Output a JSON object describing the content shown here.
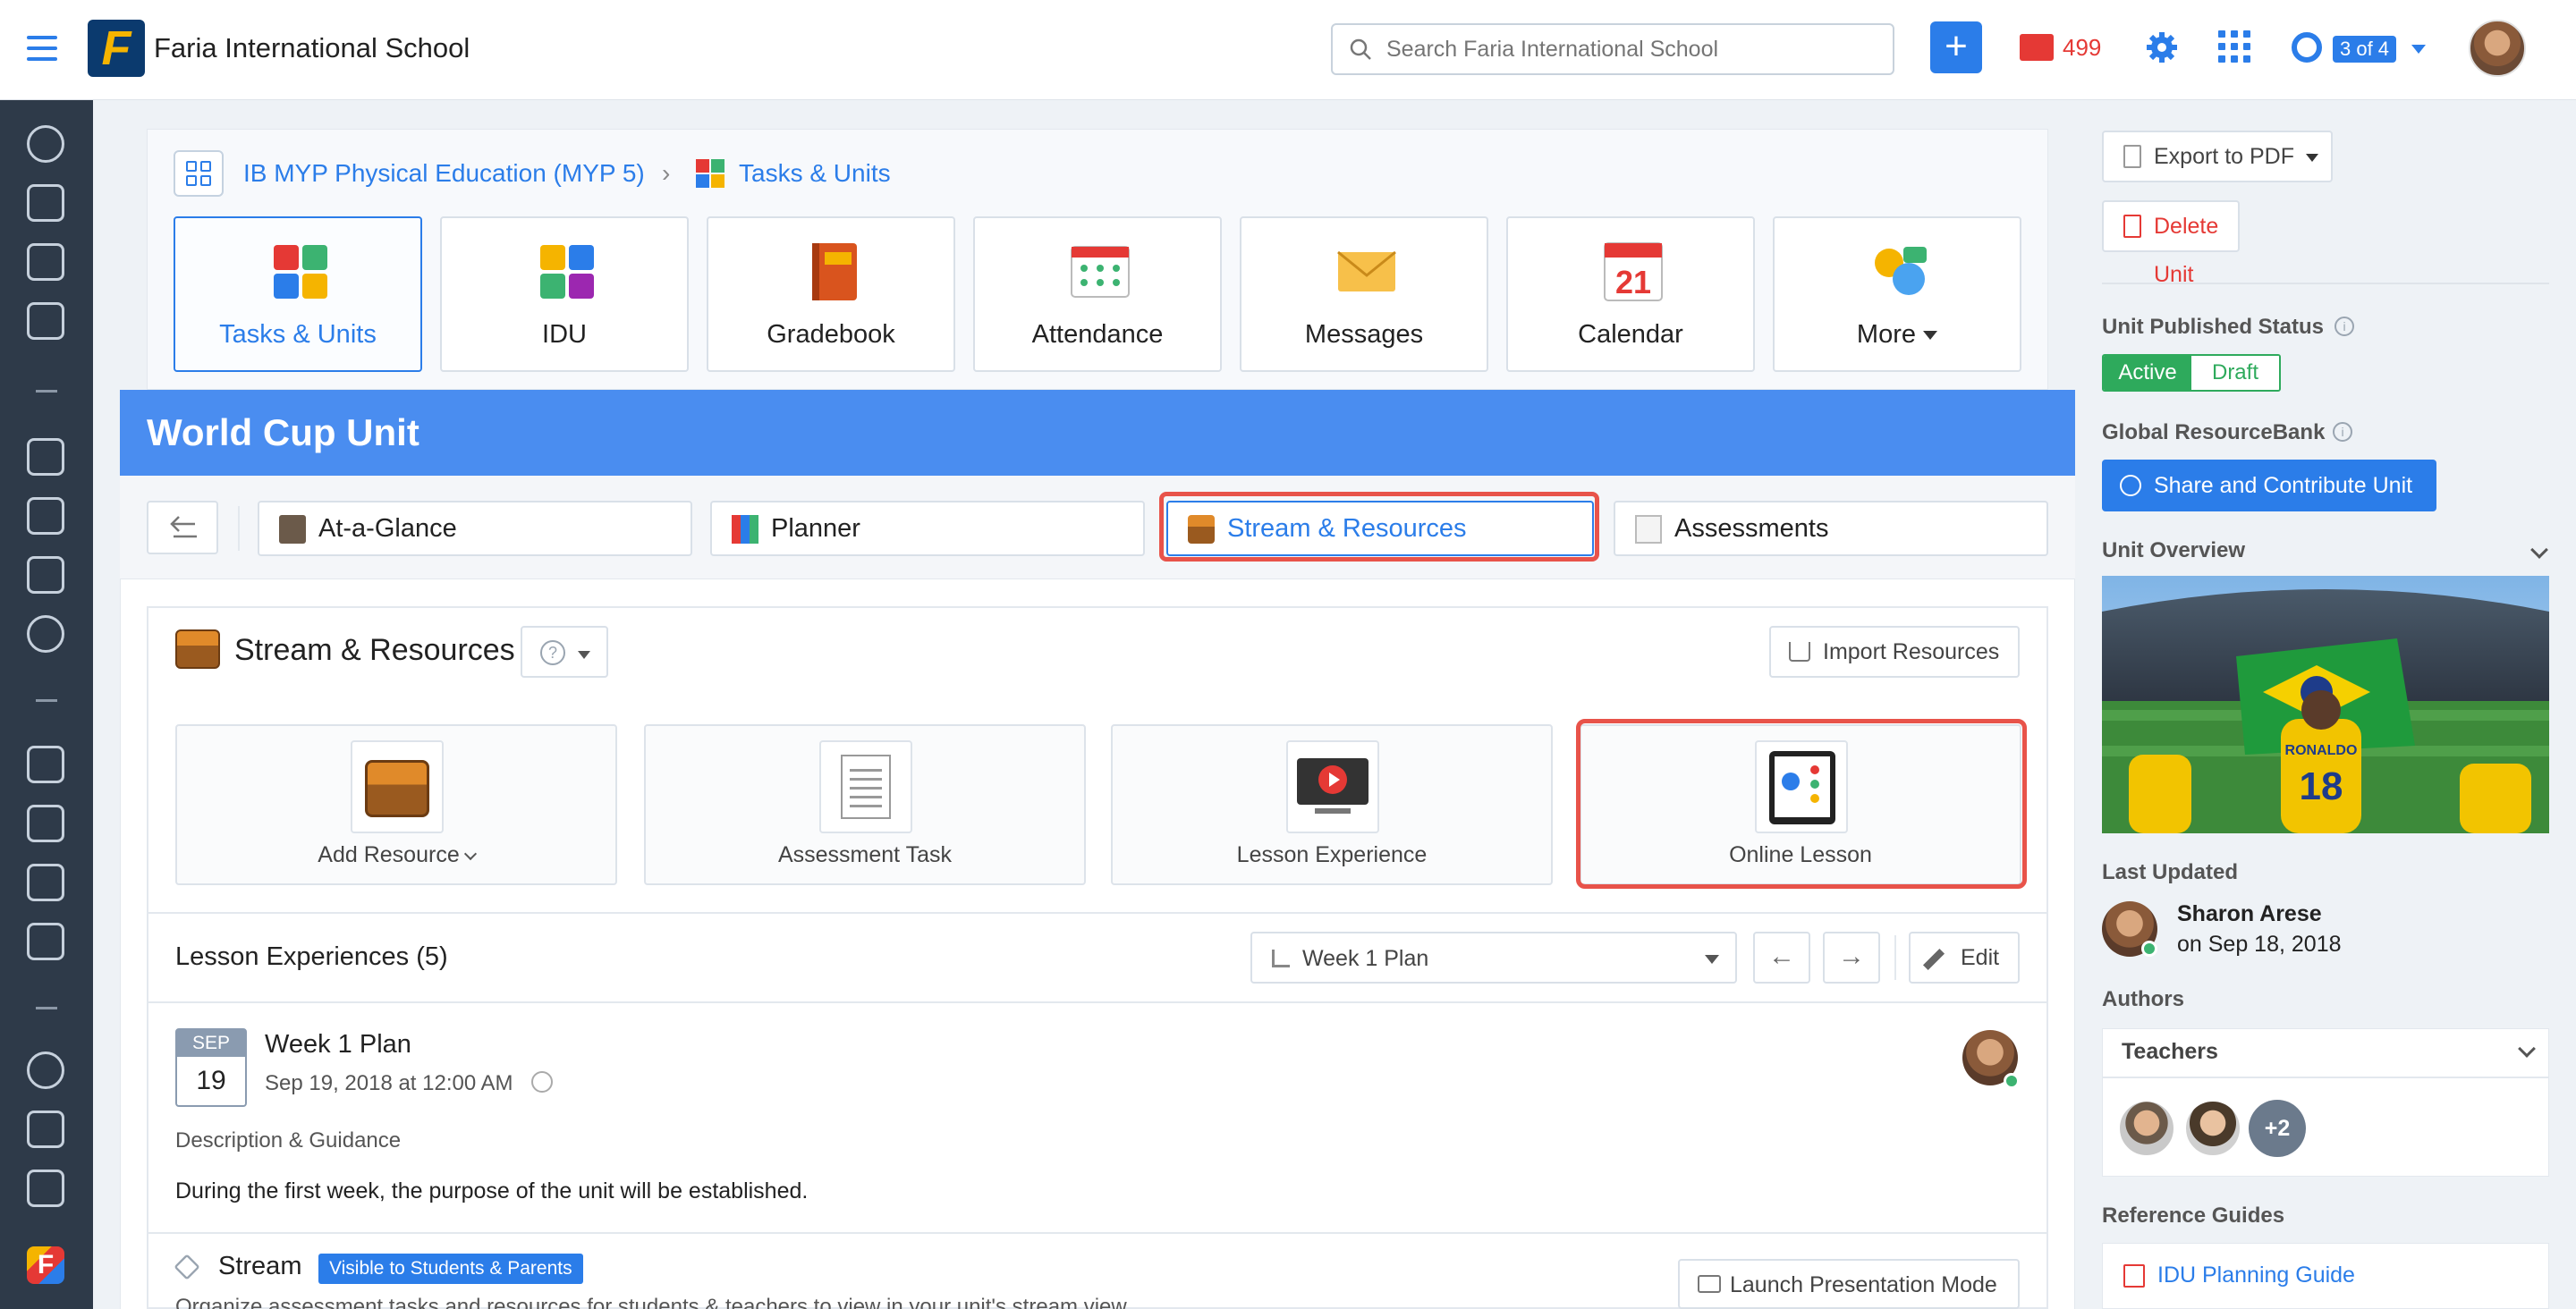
{
  "header": {
    "school_name": "Faria International School",
    "logo_letter": "F",
    "search_placeholder": "Search Faria International School",
    "add_label": "+",
    "mail_count": "499",
    "help_counter": "3 of 4"
  },
  "breadcrumb": {
    "course": "IB MYP Physical Education (MYP 5)",
    "separator": "›",
    "section": "Tasks & Units"
  },
  "tools": [
    {
      "label": "Tasks & Units",
      "icon": "puzzle-icon"
    },
    {
      "label": "IDU",
      "icon": "idu-puzzle-icon"
    },
    {
      "label": "Gradebook",
      "icon": "gradebook-icon"
    },
    {
      "label": "Attendance",
      "icon": "attendance-icon"
    },
    {
      "label": "Messages",
      "icon": "envelope-icon"
    },
    {
      "label": "Calendar",
      "icon": "calendar-icon"
    },
    {
      "label": "More",
      "icon": "more-icon"
    }
  ],
  "calendar_icon_day": "21",
  "unit": {
    "title": "World Cup Unit",
    "tabs": [
      {
        "label": "At-a-Glance"
      },
      {
        "label": "Planner"
      },
      {
        "label": "Stream & Resources"
      },
      {
        "label": "Assessments"
      }
    ]
  },
  "stream_resources": {
    "title": "Stream & Resources",
    "help": "?",
    "import_label": "Import Resources",
    "cards": [
      {
        "label": "Add Resource"
      },
      {
        "label": "Assessment Task"
      },
      {
        "label": "Lesson Experience"
      },
      {
        "label": "Online Lesson"
      }
    ]
  },
  "lessons": {
    "title": "Lesson Experiences (5)",
    "week_select": "Week 1 Plan",
    "prev": "←",
    "next": "→",
    "edit_label": "Edit",
    "item": {
      "month": "SEP",
      "day": "19",
      "title": "Week 1 Plan",
      "date": "Sep 19, 2018 at 12:00 AM",
      "desc_label": "Description & Guidance",
      "desc_text": "During the first week, the purpose of the unit will be established."
    }
  },
  "stream": {
    "title": "Stream",
    "badge": "Visible to Students & Parents",
    "description": "Organize assessment tasks and resources for students & teachers to view in your unit's stream view.",
    "launch_label": "Launch Presentation Mode"
  },
  "right_panel": {
    "export_label": "Export to PDF",
    "delete_label": "Delete Unit",
    "published_label": "Unit Published Status",
    "status_active": "Active",
    "status_draft": "Draft",
    "resourcebank_label": "Global ResourceBank",
    "share_label": "Share and Contribute Unit",
    "overview_label": "Unit Overview",
    "overview_jersey_name": "RONALDO",
    "overview_jersey_number": "18",
    "last_updated_label": "Last Updated",
    "updated_by": "Sharon Arese",
    "updated_on": "on Sep 18, 2018",
    "authors_label": "Authors",
    "teachers_label": "Teachers",
    "more_teachers": "+2",
    "ref_guides_label": "Reference Guides",
    "ref_link": "IDU Planning Guide"
  },
  "colors": {
    "brand_blue": "#2b7de9",
    "banner_blue": "#4a8df0",
    "highlight_red": "#e8534a",
    "active_green": "#2eaa5c",
    "sidebar_dark": "#2e3a49",
    "mail_red": "#e53935"
  }
}
